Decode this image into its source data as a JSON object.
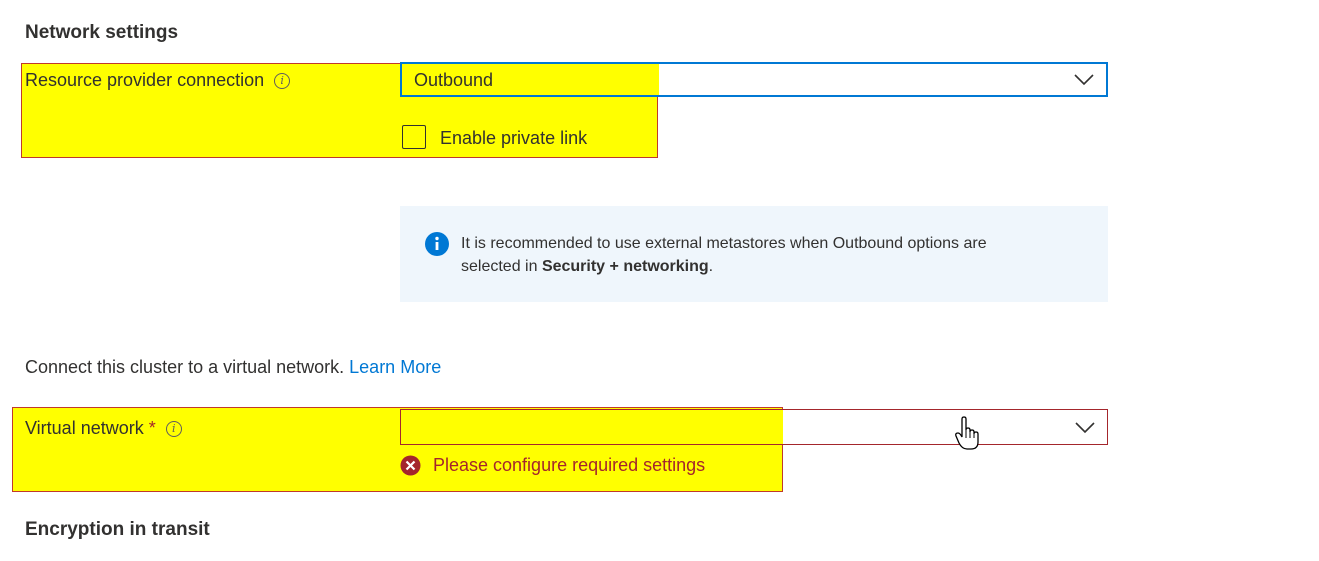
{
  "network": {
    "title": "Network settings",
    "rp_label": "Resource provider connection",
    "rp_value": "Outbound",
    "private_link_label": "Enable private link",
    "private_link_checked": false,
    "info_text_1": "It is recommended to use external metastores when Outbound options are",
    "info_text_2": "selected in ",
    "info_bold": "Security + networking",
    "info_text_3": "."
  },
  "vnet": {
    "connect_text": "Connect this cluster to a virtual network.",
    "learn_more": "Learn More",
    "label": "Virtual network",
    "required_mark": "*",
    "value": "",
    "error": "Please configure required settings"
  },
  "encryption": {
    "title": "Encryption in transit"
  },
  "colors": {
    "highlight": "#ffff00",
    "focus_border": "#0078d4",
    "error": "#a4262c",
    "link": "#0078d4",
    "info_bg": "#eff6fc"
  },
  "icons": [
    "info-circle-icon",
    "chevron-down-icon",
    "info-filled-icon",
    "error-circle-icon",
    "hand-cursor-icon"
  ]
}
